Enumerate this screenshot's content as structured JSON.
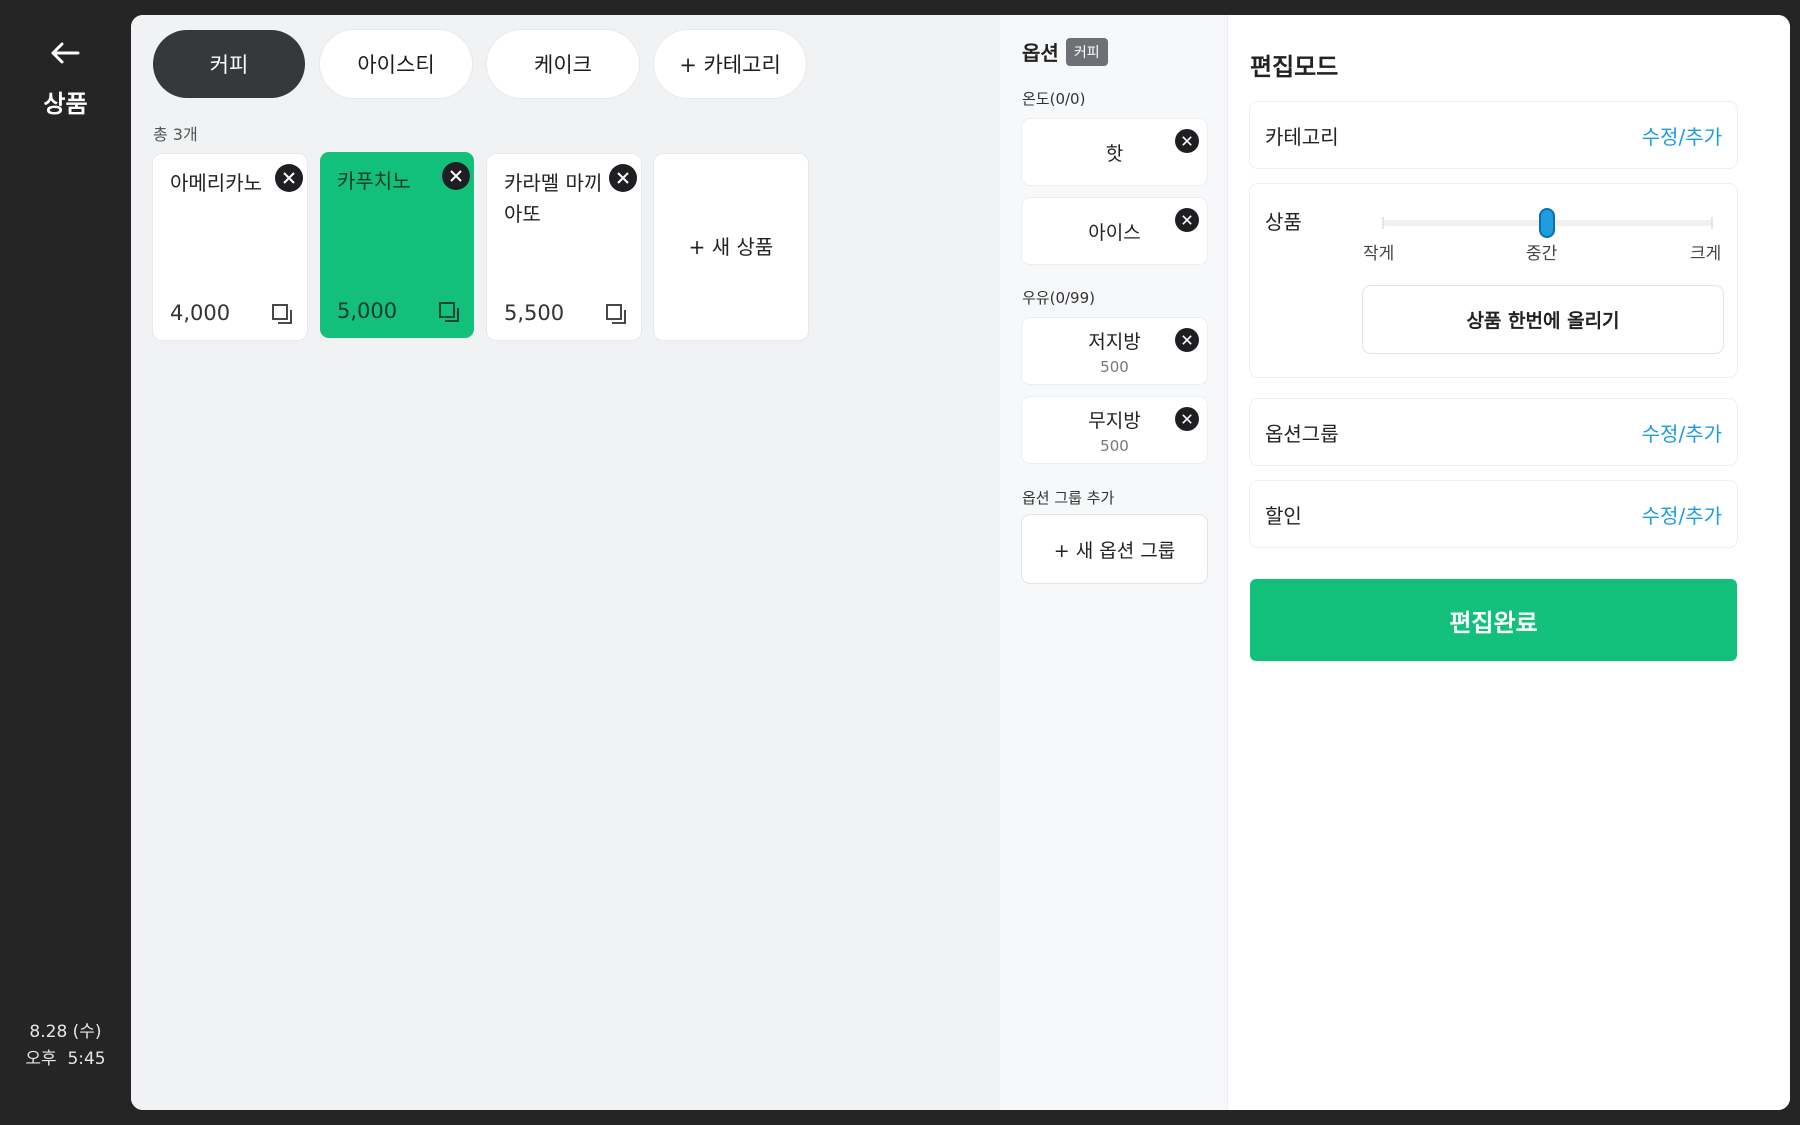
{
  "rail": {
    "title": "상품",
    "date": "8.28 (수)",
    "time": "오후  5:45"
  },
  "categories": {
    "tabs": [
      "커피",
      "아이스티",
      "케이크",
      "+ 카테고리"
    ],
    "active": "커피"
  },
  "products": {
    "count_label": "총 3개",
    "items": [
      {
        "name": "아메리카노",
        "price": "4,000",
        "selected": false
      },
      {
        "name": "카푸치노",
        "price": "5,000",
        "selected": true
      },
      {
        "name": "카라멜 마끼아또",
        "price": "5,500",
        "selected": false
      }
    ],
    "add_label": "+ 새 상품"
  },
  "options": {
    "title": "옵션",
    "category_chip": "커피",
    "groups": [
      {
        "label": "온도(0/0)",
        "items": [
          {
            "name": "핫",
            "price": ""
          },
          {
            "name": "아이스",
            "price": ""
          }
        ]
      },
      {
        "label": "우유(0/99)",
        "items": [
          {
            "name": "저지방",
            "price": "500"
          },
          {
            "name": "무지방",
            "price": "500"
          }
        ]
      }
    ],
    "add_group_label": "옵션 그룹 추가",
    "add_group_button": "+ 새 옵션 그룹"
  },
  "edit": {
    "heading": "편집모드",
    "category_label": "카테고리",
    "link_label": "수정/추가",
    "product_label": "상품",
    "size_labels": [
      "작게",
      "중간",
      "크게"
    ],
    "size_value": "중간",
    "bulk_upload": "상품 한번에 올리기",
    "option_group_label": "옵션그룹",
    "discount_label": "할인",
    "done_label": "편집완료"
  },
  "colors": {
    "accent_green": "#12c07c",
    "link_blue": "#1e9ce0",
    "dark": "#36383c"
  }
}
